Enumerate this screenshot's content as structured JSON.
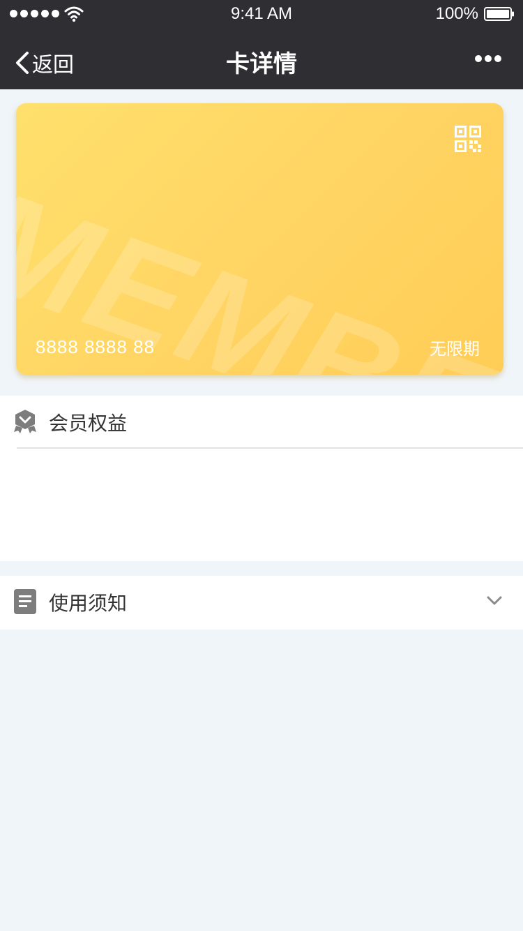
{
  "status_bar": {
    "time": "9:41 AM",
    "battery": "100%"
  },
  "nav": {
    "back_label": "返回",
    "title": "卡详情"
  },
  "card": {
    "watermark": "MEMBER",
    "number": "8888 8888 88",
    "expiry": "无限期",
    "colors": {
      "gradient_start": "#ffe06c",
      "gradient_end": "#ffcd55"
    }
  },
  "sections": {
    "benefits": {
      "title": "会员权益",
      "icon": "member-badge-icon"
    },
    "notice": {
      "title": "使用须知",
      "icon": "document-icon",
      "expand_icon": "chevron-down-icon"
    }
  },
  "colors": {
    "nav_background": "#2f2e33",
    "page_background": "#f0f5f9"
  }
}
